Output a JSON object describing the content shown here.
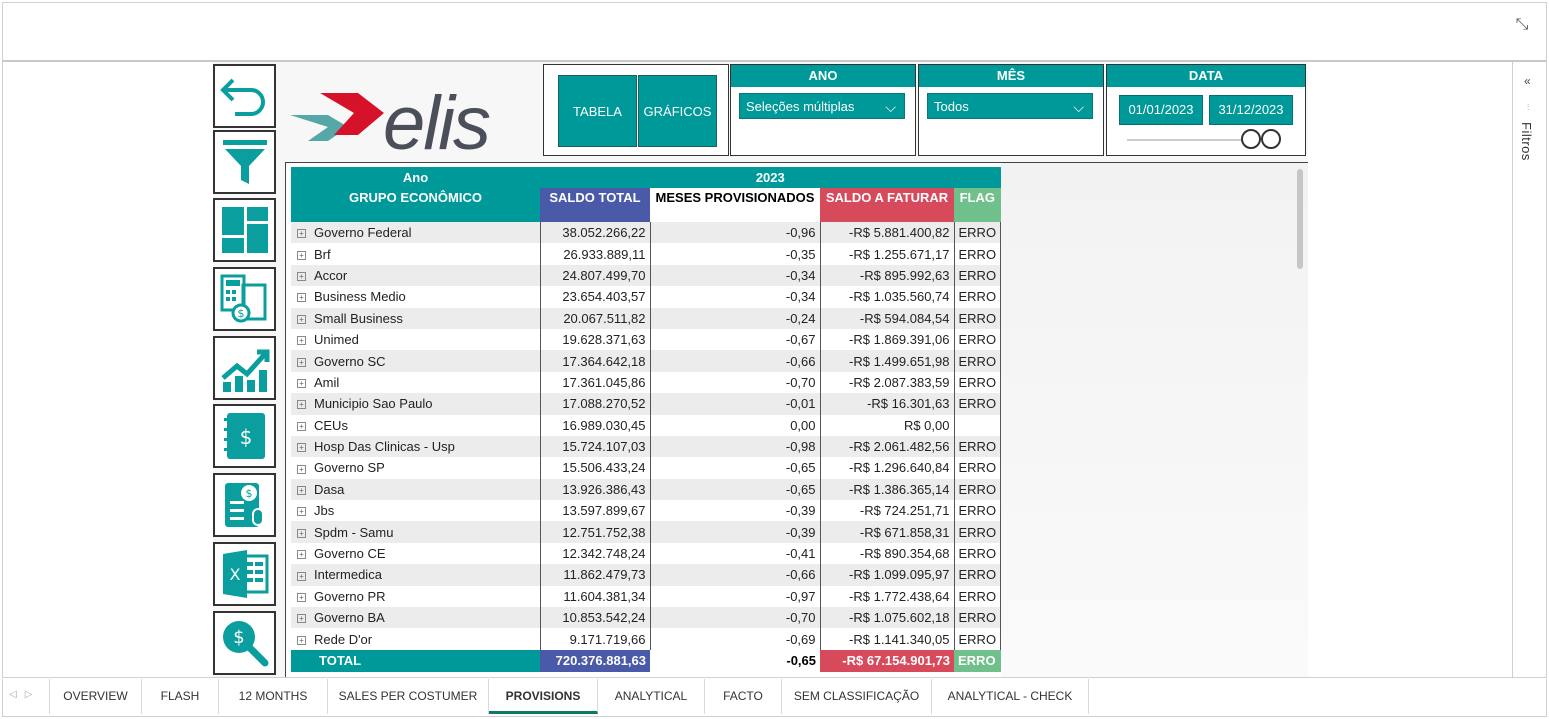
{
  "toolbar": {
    "tabela_label": "TABELA",
    "graficos_label": "GRÁFICOS"
  },
  "logo": {
    "text": "elis"
  },
  "slicers": {
    "ano": {
      "title": "ANO",
      "value": "Seleções múltiplas"
    },
    "mes": {
      "title": "MÊS",
      "value": "Todos"
    },
    "data": {
      "title": "DATA",
      "start": "01/01/2023",
      "end": "31/12/2023"
    }
  },
  "filters_pane": {
    "label": "Filtros",
    "collapse_icon": "chevron-double-left-icon"
  },
  "nav_icons": [
    "undo-arrow-icon",
    "filter-funnel-icon",
    "dashboard-grid-icon",
    "calculator-invoice-icon",
    "growth-chart-icon",
    "dollar-notebook-icon",
    "dollar-report-icon",
    "excel-icon",
    "dollar-search-icon"
  ],
  "table": {
    "header_row1": {
      "ano": "Ano",
      "year": "2023"
    },
    "columns": {
      "grupo": "GRUPO ECONÔMICO",
      "saldo_total": "SALDO TOTAL",
      "meses": "MESES PROVISIONADOS",
      "saldo_faturar": "SALDO A FATURAR",
      "flag": "FLAG"
    },
    "rows": [
      {
        "name": "Governo Federal",
        "saldo": "38.052.266,22",
        "meses": "-0,96",
        "faturar": "-R$ 5.881.400,82",
        "flag": "ERRO"
      },
      {
        "name": "Brf",
        "saldo": "26.933.889,11",
        "meses": "-0,35",
        "faturar": "-R$ 1.255.671,17",
        "flag": "ERRO"
      },
      {
        "name": "Accor",
        "saldo": "24.807.499,70",
        "meses": "-0,34",
        "faturar": "-R$ 895.992,63",
        "flag": "ERRO"
      },
      {
        "name": "Business Medio",
        "saldo": "23.654.403,57",
        "meses": "-0,34",
        "faturar": "-R$ 1.035.560,74",
        "flag": "ERRO"
      },
      {
        "name": "Small Business",
        "saldo": "20.067.511,82",
        "meses": "-0,24",
        "faturar": "-R$ 594.084,54",
        "flag": "ERRO"
      },
      {
        "name": "Unimed",
        "saldo": "19.628.371,63",
        "meses": "-0,67",
        "faturar": "-R$ 1.869.391,06",
        "flag": "ERRO"
      },
      {
        "name": "Governo SC",
        "saldo": "17.364.642,18",
        "meses": "-0,66",
        "faturar": "-R$ 1.499.651,98",
        "flag": "ERRO"
      },
      {
        "name": "Amil",
        "saldo": "17.361.045,86",
        "meses": "-0,70",
        "faturar": "-R$ 2.087.383,59",
        "flag": "ERRO"
      },
      {
        "name": "Municipio Sao Paulo",
        "saldo": "17.088.270,52",
        "meses": "-0,01",
        "faturar": "-R$ 16.301,63",
        "flag": "ERRO"
      },
      {
        "name": "CEUs",
        "saldo": "16.989.030,45",
        "meses": "0,00",
        "faturar": "R$ 0,00",
        "flag": ""
      },
      {
        "name": "Hosp Das Clinicas - Usp",
        "saldo": "15.724.107,03",
        "meses": "-0,98",
        "faturar": "-R$ 2.061.482,56",
        "flag": "ERRO"
      },
      {
        "name": "Governo SP",
        "saldo": "15.506.433,24",
        "meses": "-0,65",
        "faturar": "-R$ 1.296.640,84",
        "flag": "ERRO"
      },
      {
        "name": "Dasa",
        "saldo": "13.926.386,43",
        "meses": "-0,65",
        "faturar": "-R$ 1.386.365,14",
        "flag": "ERRO"
      },
      {
        "name": "Jbs",
        "saldo": "13.597.899,67",
        "meses": "-0,39",
        "faturar": "-R$ 724.251,71",
        "flag": "ERRO"
      },
      {
        "name": "Spdm - Samu",
        "saldo": "12.751.752,38",
        "meses": "-0,39",
        "faturar": "-R$ 671.858,31",
        "flag": "ERRO"
      },
      {
        "name": "Governo CE",
        "saldo": "12.342.748,24",
        "meses": "-0,41",
        "faturar": "-R$ 890.354,68",
        "flag": "ERRO"
      },
      {
        "name": "Intermedica",
        "saldo": "11.862.479,73",
        "meses": "-0,66",
        "faturar": "-R$ 1.099.095,97",
        "flag": "ERRO"
      },
      {
        "name": "Governo PR",
        "saldo": "11.604.381,34",
        "meses": "-0,97",
        "faturar": "-R$ 1.772.438,64",
        "flag": "ERRO"
      },
      {
        "name": "Governo BA",
        "saldo": "10.853.542,24",
        "meses": "-0,70",
        "faturar": "-R$ 1.075.602,18",
        "flag": "ERRO"
      },
      {
        "name": "Rede D'or",
        "saldo": "9.171.719,66",
        "meses": "-0,69",
        "faturar": "-R$ 1.141.340,05",
        "flag": "ERRO"
      }
    ],
    "total": {
      "label": "TOTAL",
      "saldo": "720.376.881,63",
      "meses": "-0,65",
      "faturar": "-R$ 67.154.901,73",
      "flag": "ERRO"
    }
  },
  "tabs": [
    "OVERVIEW",
    "FLASH",
    "12 MONTHS",
    "SALES PER COSTUMER",
    "PROVISIONS",
    "ANALYTICAL",
    "FACTO",
    "SEM CLASSIFICAÇÃO",
    "ANALYTICAL - CHECK"
  ],
  "active_tab": "PROVISIONS",
  "colors": {
    "teal": "#009999",
    "blue": "#4a5aa8",
    "red": "#d64a5c",
    "green": "#6fc08a",
    "logo_red": "#d6122b",
    "logo_gray": "#4a4f5a"
  }
}
